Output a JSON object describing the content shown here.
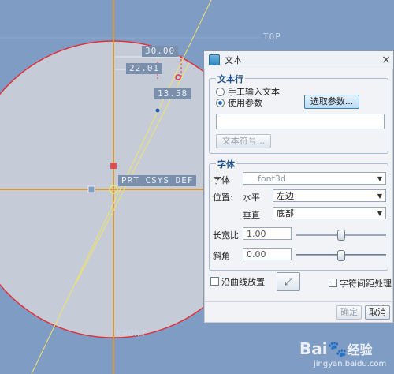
{
  "cad": {
    "plane_top": "TOP",
    "plane_front": "FRONT",
    "csys": "PRT_CSYS_DEF",
    "dim_30": "30.00",
    "dim_22": "22.01",
    "dim_13": "13.58"
  },
  "dialog": {
    "title": "文本",
    "close": "×",
    "text_row": {
      "title": "文本行",
      "option_manual": "手工输入文本",
      "option_param": "使用参数",
      "select_param_button": "选取参数...",
      "text_value": "",
      "text_symbol_button": "文本符号..."
    },
    "font_group": {
      "title": "字体",
      "font_label": "字体",
      "font_value": "font3d",
      "position_label": "位置:",
      "horizontal_label": "水平",
      "horizontal_value": "左边",
      "vertical_label": "垂直",
      "vertical_value": "底部",
      "aspect_label": "长宽比",
      "aspect_value": "1.00",
      "slant_label": "斜角",
      "slant_value": "0.00"
    },
    "curve_place_label": "沿曲线放置",
    "char_spacing_label": "字符间距处理",
    "ok": "确定",
    "cancel": "取消"
  },
  "watermark": {
    "brand": "Bai",
    "brand2": "经验",
    "url": "jingyan.baidu.com"
  },
  "colors": {
    "background": "#7f9cc4",
    "circle_fill": "#c5ccd8",
    "circle_edge": "#e0323c",
    "sketch_line": "#f0e36a",
    "accent": "#1f4f8a"
  }
}
